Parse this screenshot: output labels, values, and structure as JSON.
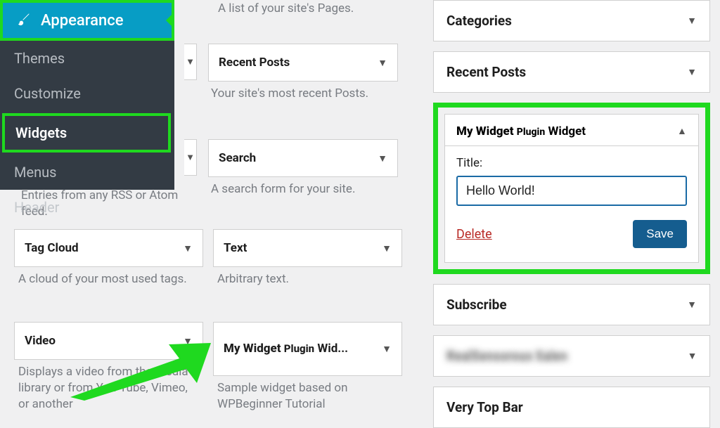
{
  "sidebar": {
    "appearance_label": "Appearance",
    "themes": "Themes",
    "customize": "Customize",
    "widgets": "Widgets",
    "menus": "Menus",
    "header": "Header"
  },
  "widgets": {
    "pages_desc": "A list of your site's Pages.",
    "recent_posts": {
      "title": "Recent Posts",
      "desc": "Your site's most recent Posts."
    },
    "search": {
      "title": "Search",
      "desc": "A search form for your site."
    },
    "rss_desc": "Entries from any RSS or Atom feed.",
    "tag_cloud": {
      "title": "Tag Cloud",
      "desc": "A cloud of your most used tags."
    },
    "text": {
      "title": "Text",
      "desc": "Arbitrary text."
    },
    "video": {
      "title": "Video",
      "desc": "Displays a video from the media library or from You-Tube, Vimeo, or another"
    },
    "my_widget": {
      "prefix": "My Widget",
      "plugin": "Plugin",
      "suffix": "Wid...",
      "desc": "Sample widget based on WPBeginner Tutorial"
    }
  },
  "right": {
    "categories": "Categories",
    "recent_posts": "Recent Posts",
    "subscribe": "Subscribe",
    "blurred": "RealSensorous Salen",
    "very_top": "Very Top Bar",
    "custom": {
      "prefix": "My Widget",
      "plugin": "Plugin",
      "suffix": "Widget",
      "title_label": "Title:",
      "title_value": "Hello World!",
      "delete": "Delete",
      "save": "Save"
    }
  }
}
